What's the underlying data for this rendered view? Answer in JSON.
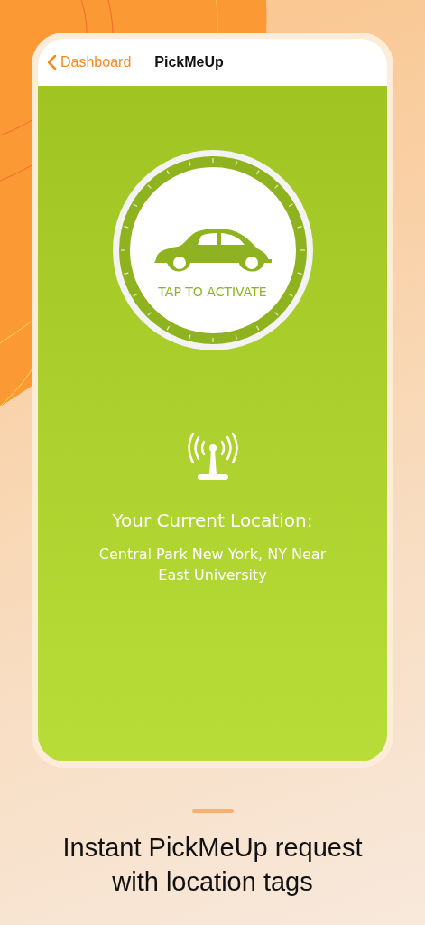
{
  "nav_bar": {
    "back_label": "Dashboard",
    "title": "PickMeUp"
  },
  "activate_button": {
    "label": "TAP TO ACTIVATE"
  },
  "location": {
    "heading": "Your Current Location:",
    "address": "Central Park New York, NY Near East University"
  },
  "tagline": "Instant PickMeUp request with location tags"
}
